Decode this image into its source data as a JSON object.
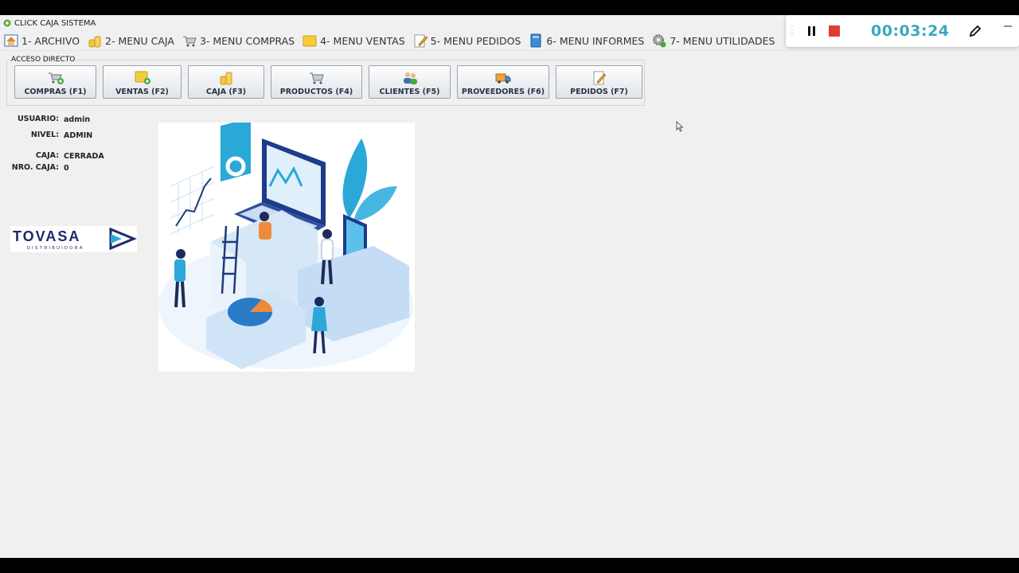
{
  "window": {
    "title": "CLICK CAJA SISTEMA"
  },
  "menu": [
    {
      "label": "1- ARCHIVO",
      "icon": "home-icon"
    },
    {
      "label": "2- MENU CAJA",
      "icon": "coins-icon"
    },
    {
      "label": "3- MENU COMPRAS",
      "icon": "cart-icon"
    },
    {
      "label": "4- MENU VENTAS",
      "icon": "folder-icon"
    },
    {
      "label": "5- MENU PEDIDOS",
      "icon": "edit-icon"
    },
    {
      "label": "6- MENU INFORMES",
      "icon": "book-icon"
    },
    {
      "label": "7- MENU UTILIDADES",
      "icon": "gear-icon"
    }
  ],
  "acceso_directo": {
    "title": "ACCESO DIRECTO",
    "buttons": [
      {
        "label": "COMPRAS (F1)",
        "icon": "cart-add-icon"
      },
      {
        "label": "VENTAS (F2)",
        "icon": "folder-add-icon"
      },
      {
        "label": "CAJA (F3)",
        "icon": "coins-icon"
      },
      {
        "label": "PRODUCTOS (F4)",
        "icon": "cart-icon"
      },
      {
        "label": "CLIENTES (F5)",
        "icon": "users-icon"
      },
      {
        "label": "PROVEEDORES (F6)",
        "icon": "truck-icon"
      },
      {
        "label": "PEDIDOS (F7)",
        "icon": "note-edit-icon"
      }
    ]
  },
  "session": {
    "usuario_label": "USUARIO:",
    "usuario": "admin",
    "nivel_label": "NIVEL:",
    "nivel": "ADMIN",
    "caja_label": "CAJA:",
    "caja": "CERRADA",
    "nro_caja_label": "NRO. CAJA:",
    "nro_caja": "0"
  },
  "logo": {
    "text": "TOVASA",
    "subtitle": "DISTRIBUIDORA"
  },
  "recorder": {
    "timer": "00:03:24",
    "record_color": "#e03c31",
    "timer_color": "#3aa8c0"
  }
}
